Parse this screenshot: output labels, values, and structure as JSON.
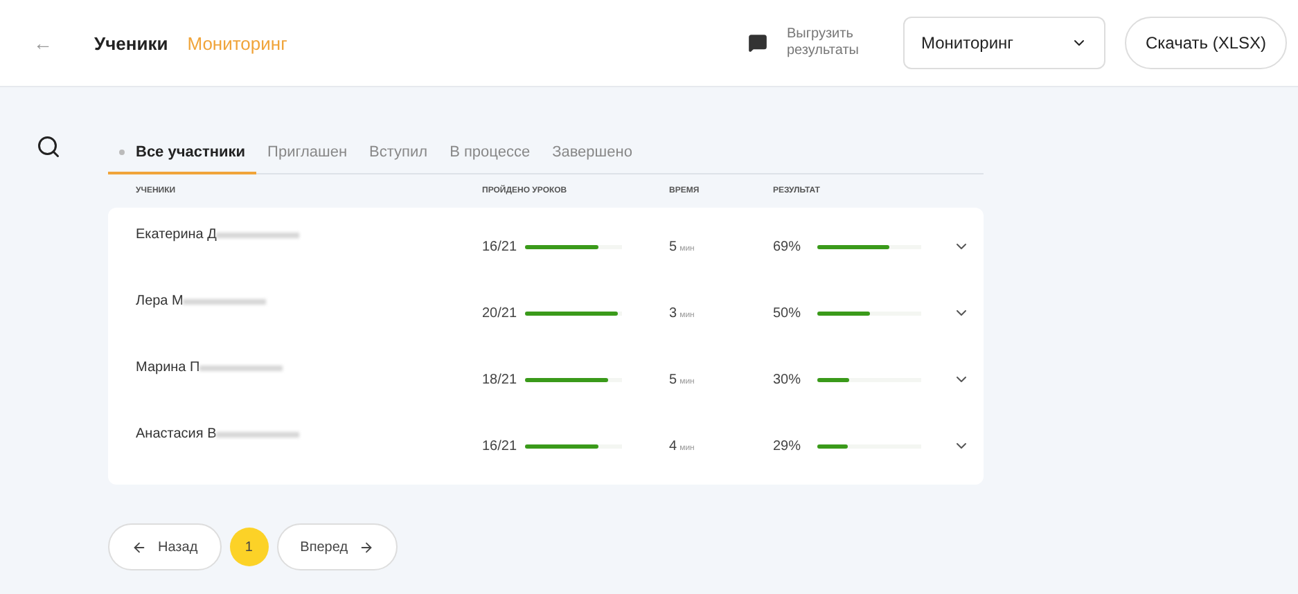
{
  "header": {
    "back": "←",
    "tabs": [
      {
        "label": "Ученики",
        "selected": false
      },
      {
        "label": "Мониторинг",
        "selected": true
      }
    ],
    "export_label": "Выгрузить результаты",
    "select_value": "Мониторинг",
    "download": "Скачать (XLSX)"
  },
  "filters": [
    {
      "label": "Все участники",
      "selected": true
    },
    {
      "label": "Приглашен",
      "selected": false
    },
    {
      "label": "Вступил",
      "selected": false
    },
    {
      "label": "В процессе",
      "selected": false
    },
    {
      "label": "Завершено",
      "selected": false
    }
  ],
  "table": {
    "columns": [
      "УЧЕНИКИ",
      "ПРОЙДЕНО УРОКОВ",
      "ВРЕМЯ",
      "РЕЗУЛЬТАТ"
    ],
    "rows": [
      {
        "name": "Екатерина Д",
        "lessons": {
          "count": "16/21",
          "level": 0.76
        },
        "time": "5",
        "time_unit": "мин",
        "result": "69%",
        "level": 0.69
      },
      {
        "name": "Лера М",
        "lessons": {
          "count": "20/21",
          "level": 0.95
        },
        "time": "3",
        "time_unit": "мин",
        "result": "50%",
        "level": 0.5
      },
      {
        "name": "Марина П",
        "lessons": {
          "count": "18/21",
          "level": 0.86
        },
        "time": "5",
        "time_unit": "мин",
        "result": "30%",
        "level": 0.3
      },
      {
        "name": "Анастасия В",
        "lessons": {
          "count": "16/21",
          "level": 0.76
        },
        "time": "4",
        "time_unit": "мин",
        "result": "29%",
        "level": 0.29
      }
    ]
  },
  "pagination": {
    "prev": "Назад",
    "pages": [
      {
        "label": "1",
        "selected": true
      }
    ],
    "next": "Вперед"
  }
}
